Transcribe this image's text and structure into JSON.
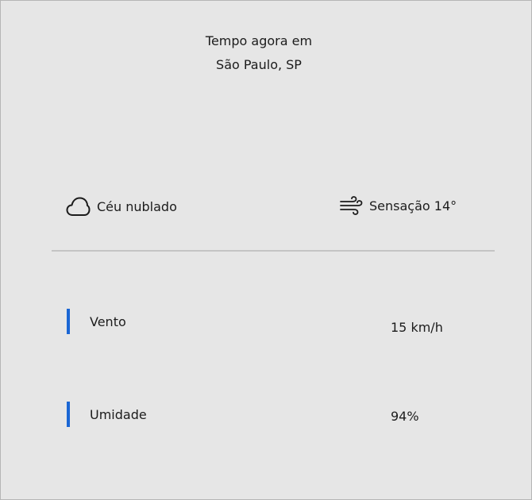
{
  "header": {
    "line1": "Tempo agora em",
    "line2": "São Paulo, SP"
  },
  "conditions": {
    "sky": {
      "icon": "cloud-icon",
      "label": "Céu nublado"
    },
    "feels_like": {
      "icon": "wind-icon",
      "label": "Sensação 14°"
    }
  },
  "details": [
    {
      "label": "Vento",
      "value": "15 km/h"
    },
    {
      "label": "Umidade",
      "value": "94%"
    }
  ],
  "colors": {
    "accent": "#1a66d4",
    "background": "#e6e6e6",
    "divider": "#c4c4c4"
  }
}
